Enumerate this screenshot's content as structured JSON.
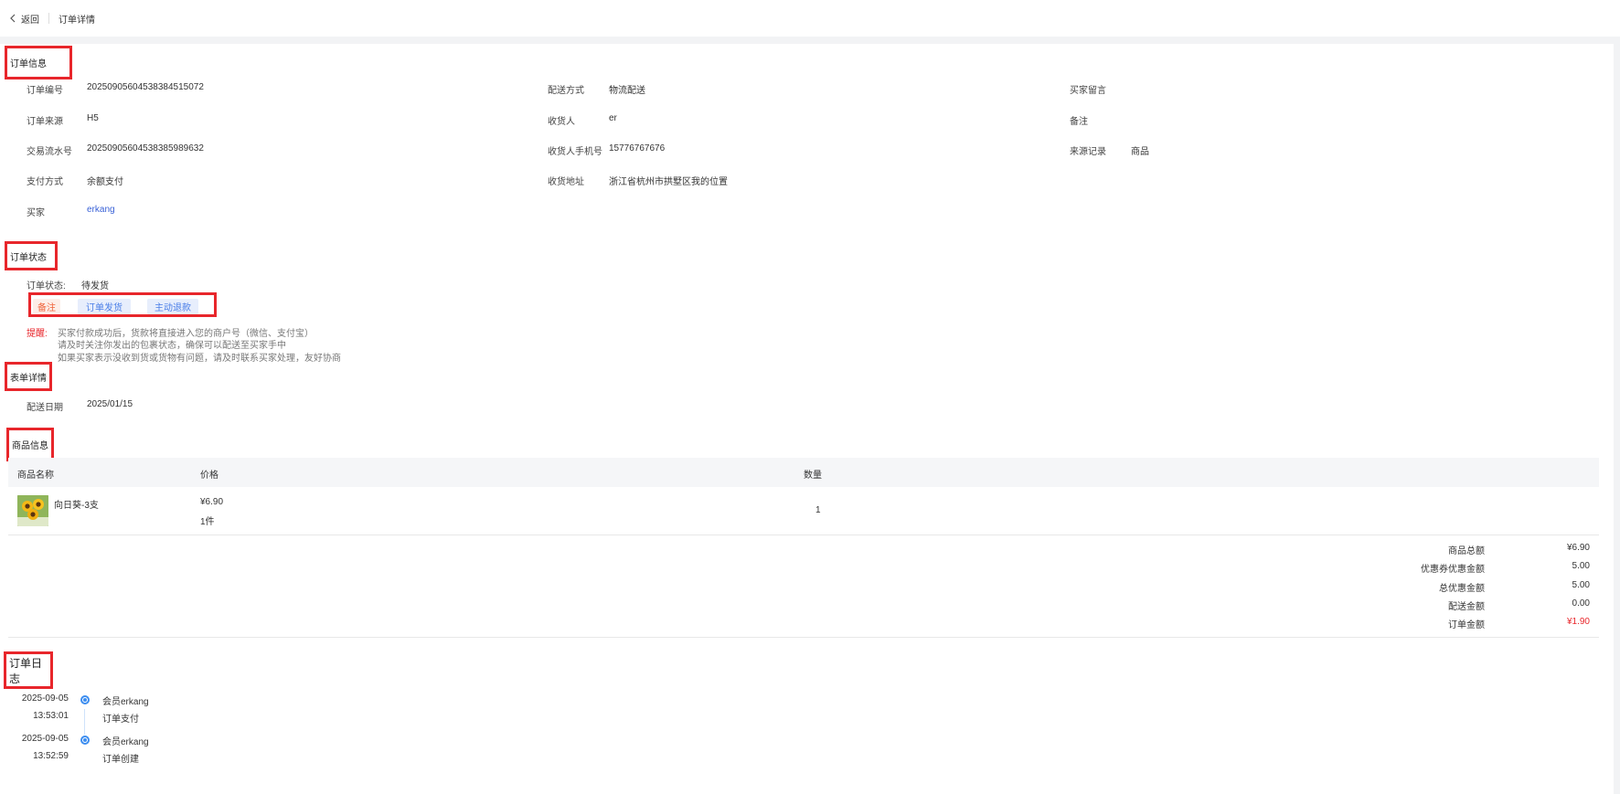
{
  "header": {
    "back_label": "返回",
    "breadcrumb": "订单详情"
  },
  "sections": {
    "order_info": "订单信息",
    "order_status": "订单状态",
    "form_detail": "表单详情",
    "goods_info": "商品信息",
    "order_log": "订单日志"
  },
  "order_info": {
    "order_no_label": "订单编号",
    "order_no": "20250905604538384515072",
    "source_label": "订单来源",
    "source": "H5",
    "txn_label": "交易流水号",
    "txn": "20250905604538385989632",
    "pay_label": "支付方式",
    "pay": "余额支付",
    "buyer_label": "买家",
    "buyer": "erkang",
    "ship_label": "配送方式",
    "ship": "物流配送",
    "receiver_label": "收货人",
    "receiver": "er",
    "phone_label": "收货人手机号",
    "phone": "15776767676",
    "address_label": "收货地址",
    "address": "浙江省杭州市拱墅区我的位置",
    "message_label": "买家留言",
    "message": "",
    "remark_label": "备注",
    "remark": "",
    "origin_label": "来源记录",
    "origin": "商品"
  },
  "order_status": {
    "status_label": "订单状态:",
    "status": "待发货",
    "buttons": {
      "note": "备注",
      "ship": "订单发货",
      "refund": "主动退款"
    },
    "tip_label": "提醒:",
    "tips": [
      "买家付款成功后，货款将直接进入您的商户号（微信、支付宝）",
      "请及时关注你发出的包裹状态，确保可以配送至买家手中",
      "如果买家表示没收到货或货物有问题，请及时联系买家处理，友好协商"
    ]
  },
  "form_detail": {
    "date_label": "配送日期",
    "date": "2025/01/15"
  },
  "goods": {
    "columns": {
      "name": "商品名称",
      "price": "价格",
      "qty": "数量"
    },
    "rows": [
      {
        "name": "向日葵-3支",
        "price": "¥6.90",
        "unit": "1件",
        "qty": "1",
        "image": "sunflower-image"
      }
    ]
  },
  "summary": [
    {
      "label": "商品总额",
      "value": "¥6.90"
    },
    {
      "label": "优惠券优惠金额",
      "value": "5.00"
    },
    {
      "label": "总优惠金额",
      "value": "5.00"
    },
    {
      "label": "配送金额",
      "value": "0.00"
    },
    {
      "label": "订单金额",
      "value": "¥1.90"
    }
  ],
  "logs": [
    {
      "date": "2025-09-05",
      "time": "13:53:01",
      "actor": "会员erkang",
      "action": "订单支付"
    },
    {
      "date": "2025-09-05",
      "time": "13:52:59",
      "actor": "会员erkang",
      "action": "订单创建"
    }
  ],
  "colors": {
    "accent_red": "#e8262b",
    "link_blue": "#3a62d7",
    "timeline_blue": "#3d8ef0"
  }
}
